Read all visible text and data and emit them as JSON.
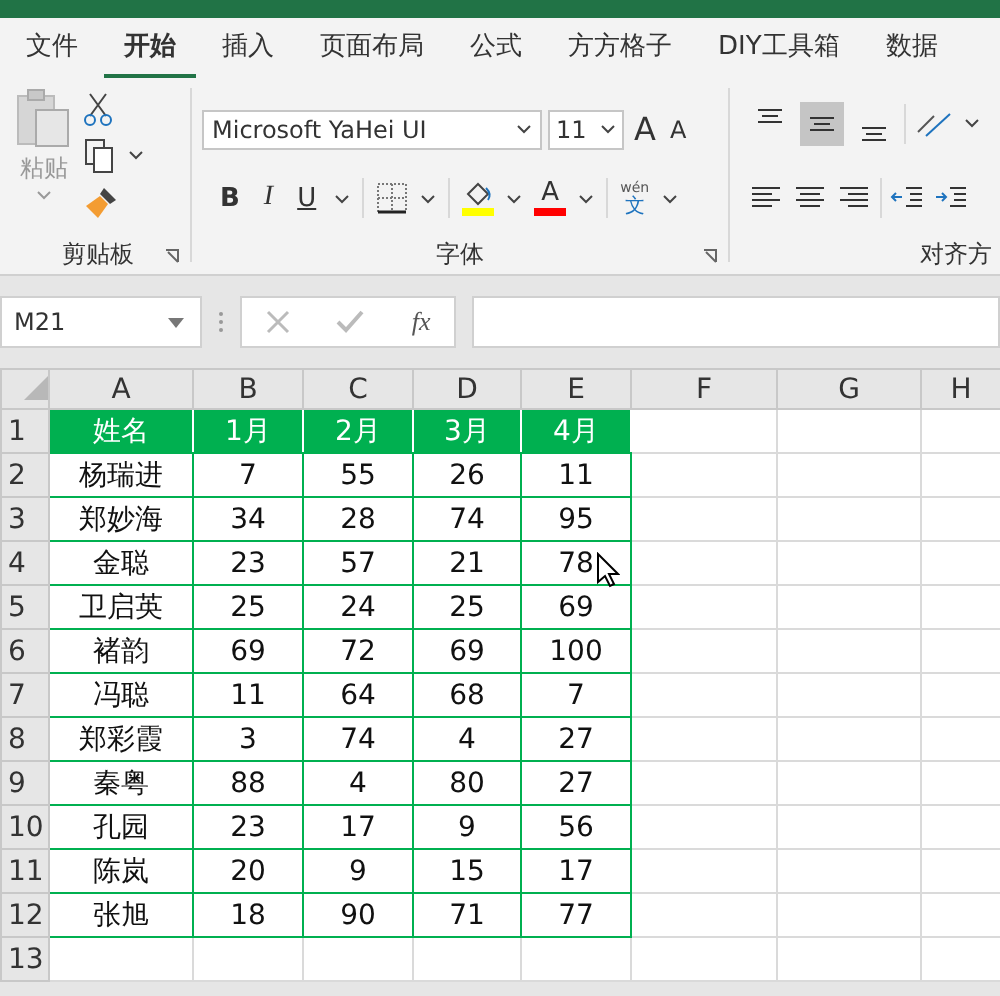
{
  "tabs": [
    {
      "label": "文件",
      "selected": false
    },
    {
      "label": "开始",
      "selected": true
    },
    {
      "label": "插入",
      "selected": false
    },
    {
      "label": "页面布局",
      "selected": false
    },
    {
      "label": "公式",
      "selected": false
    },
    {
      "label": "方方格子",
      "selected": false
    },
    {
      "label": "DIY工具箱",
      "selected": false
    },
    {
      "label": "数据",
      "selected": false
    }
  ],
  "ribbon": {
    "clipboard": {
      "paste_label": "粘贴",
      "label": "剪贴板"
    },
    "font": {
      "font_name": "Microsoft YaHei UI",
      "font_size": "11",
      "grow_glyph": "A",
      "shrink_glyph": "A",
      "style_buttons": [
        "B",
        "I",
        "U"
      ],
      "font_color_glyph": "A",
      "phonetic_top": "wén",
      "phonetic_char": "文",
      "label": "字体"
    },
    "alignment": {
      "vertical_buttons": [
        {
          "selected": false
        },
        {
          "selected": true
        },
        {
          "selected": false
        }
      ],
      "label": "对齐方"
    }
  },
  "formula_bar": {
    "name_box": "M21",
    "function_label": "fx"
  },
  "sheet": {
    "columns": [
      "A",
      "B",
      "C",
      "D",
      "E",
      "F",
      "G",
      "H"
    ],
    "rows": [
      {
        "number": "1",
        "kind": "header",
        "cells": [
          "姓名",
          "1月",
          "2月",
          "3月",
          "4月"
        ]
      },
      {
        "number": "2",
        "kind": "data",
        "cells": [
          "杨瑞进",
          "7",
          "55",
          "26",
          "11"
        ]
      },
      {
        "number": "3",
        "kind": "data",
        "cells": [
          "郑妙海",
          "34",
          "28",
          "74",
          "95"
        ]
      },
      {
        "number": "4",
        "kind": "data",
        "cells": [
          "金聪",
          "23",
          "57",
          "21",
          "78"
        ]
      },
      {
        "number": "5",
        "kind": "data",
        "cells": [
          "卫启英",
          "25",
          "24",
          "25",
          "69"
        ]
      },
      {
        "number": "6",
        "kind": "data",
        "cells": [
          "褚韵",
          "69",
          "72",
          "69",
          "100"
        ]
      },
      {
        "number": "7",
        "kind": "data",
        "cells": [
          "冯聪",
          "11",
          "64",
          "68",
          "7"
        ]
      },
      {
        "number": "8",
        "kind": "data",
        "cells": [
          "郑彩霞",
          "3",
          "74",
          "4",
          "27"
        ]
      },
      {
        "number": "9",
        "kind": "data",
        "cells": [
          "秦粤",
          "88",
          "4",
          "80",
          "27"
        ]
      },
      {
        "number": "10",
        "kind": "data",
        "cells": [
          "孔园",
          "23",
          "17",
          "9",
          "56"
        ]
      },
      {
        "number": "11",
        "kind": "data",
        "cells": [
          "陈岚",
          "20",
          "9",
          "15",
          "17"
        ]
      },
      {
        "number": "12",
        "kind": "data",
        "cells": [
          "张旭",
          "18",
          "90",
          "71",
          "77"
        ]
      },
      {
        "number": "13",
        "kind": "empty"
      }
    ]
  }
}
